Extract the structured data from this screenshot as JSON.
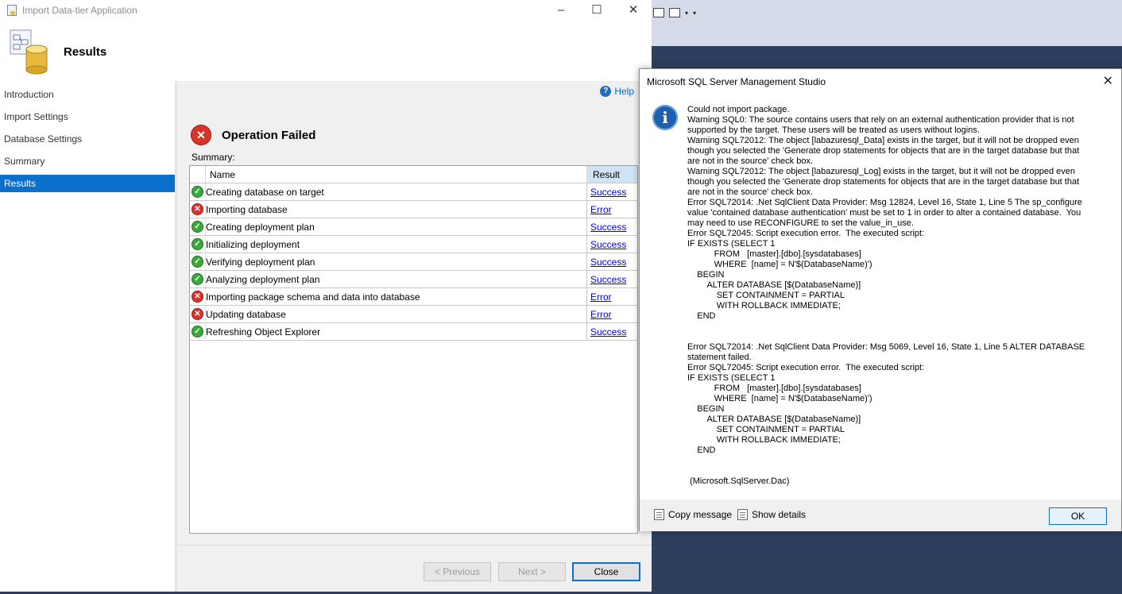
{
  "wizard": {
    "window_title": "Import Data-tier Application",
    "header_title": "Results",
    "nav": [
      {
        "label": "Introduction"
      },
      {
        "label": "Import Settings"
      },
      {
        "label": "Database Settings"
      },
      {
        "label": "Summary"
      },
      {
        "label": "Results",
        "active": true
      }
    ],
    "help_label": "Help",
    "status_title": "Operation Failed",
    "summary_label": "Summary:",
    "table": {
      "columns": [
        "Name",
        "Result"
      ],
      "rows": [
        {
          "name": "Creating database on target",
          "result": "Success",
          "status": "ok"
        },
        {
          "name": "Importing database",
          "result": "Error",
          "status": "error"
        },
        {
          "name": "Creating deployment plan",
          "result": "Success",
          "status": "ok"
        },
        {
          "name": "Initializing deployment",
          "result": "Success",
          "status": "ok"
        },
        {
          "name": "Verifying deployment plan",
          "result": "Success",
          "status": "ok"
        },
        {
          "name": "Analyzing deployment plan",
          "result": "Success",
          "status": "ok"
        },
        {
          "name": "Importing package schema and data into database",
          "result": "Error",
          "status": "error"
        },
        {
          "name": "Updating database",
          "result": "Error",
          "status": "error"
        },
        {
          "name": "Refreshing Object Explorer",
          "result": "Success",
          "status": "ok"
        }
      ]
    },
    "buttons": {
      "previous": "< Previous",
      "next": "Next >",
      "close": "Close"
    }
  },
  "message_box": {
    "title": "Microsoft SQL Server Management Studio",
    "message": "Could not import package.\nWarning SQL0: The source contains users that rely on an external authentication provider that is not\nsupported by the target. These users will be treated as users without logins.\nWarning SQL72012: The object [labazuresql_Data] exists in the target, but it will not be dropped even\nthough you selected the 'Generate drop statements for objects that are in the target database but that\nare not in the source' check box.\nWarning SQL72012: The object [labazuresql_Log] exists in the target, but it will not be dropped even\nthough you selected the 'Generate drop statements for objects that are in the target database but that\nare not in the source' check box.\nError SQL72014: .Net SqlClient Data Provider: Msg 12824, Level 16, State 1, Line 5 The sp_configure\nvalue 'contained database authentication' must be set to 1 in order to alter a contained database.  You\nmay need to use RECONFIGURE to set the value_in_use.\nError SQL72045: Script execution error.  The executed script:\nIF EXISTS (SELECT 1\n           FROM   [master].[dbo].[sysdatabases]\n           WHERE  [name] = N'$(DatabaseName)')\n    BEGIN\n        ALTER DATABASE [$(DatabaseName)]\n            SET CONTAINMENT = PARTIAL\n            WITH ROLLBACK IMMEDIATE;\n    END\n\n\nError SQL72014: .Net SqlClient Data Provider: Msg 5069, Level 16, State 1, Line 5 ALTER DATABASE\nstatement failed.\nError SQL72045: Script execution error.  The executed script:\nIF EXISTS (SELECT 1\n           FROM   [master].[dbo].[sysdatabases]\n           WHERE  [name] = N'$(DatabaseName)')\n    BEGIN\n        ALTER DATABASE [$(DatabaseName)]\n            SET CONTAINMENT = PARTIAL\n            WITH ROLLBACK IMMEDIATE;\n    END\n\n\n (Microsoft.SqlServer.Dac)",
    "copy_label": "Copy message",
    "details_label": "Show details",
    "ok_label": "OK"
  },
  "icons": {
    "info": "information-icon",
    "success": "check-circle-icon",
    "error": "error-circle-icon"
  },
  "colors": {
    "selection": "#0b6fce",
    "error": "#d9342b",
    "success": "#3aa83a",
    "backdrop": "#2d3e5e"
  }
}
